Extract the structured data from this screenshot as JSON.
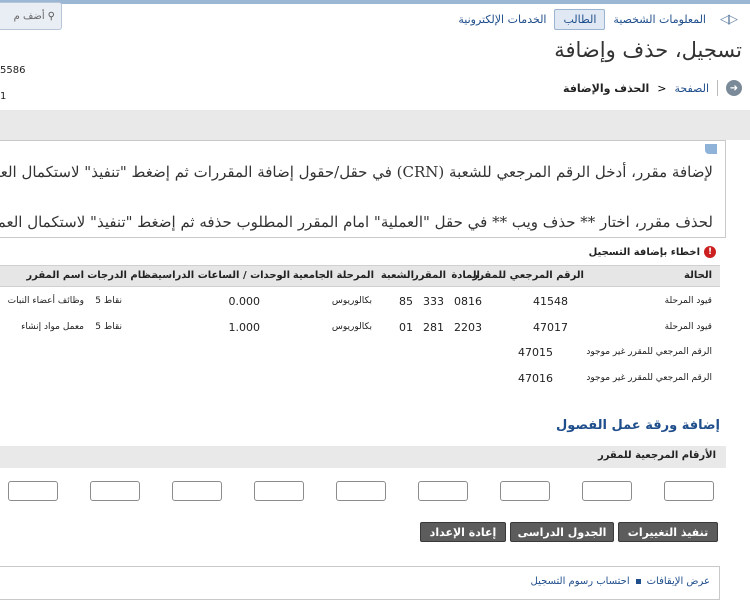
{
  "nav": {
    "tabs": [
      "المعلومات الشخصية",
      "الطالب",
      "الخدمات الإلكترونية"
    ],
    "active_index": 1
  },
  "search": {
    "placeholder": "أضف م"
  },
  "page": {
    "title": "تسجيل، حذف وإضافة",
    "left_number_1": "5586",
    "left_number_2": "1"
  },
  "breadcrumb": {
    "home": "الصفحة",
    "separator": ">",
    "current": "الحذف والإضافة"
  },
  "info": {
    "line1": "لإضافة مقرر، أدخل الرقم المرجعي للشعبة (CRN) في حقل/حقول إضافة المقررات ثم إضغط \"تنفيذ\" لاستكمال العملية.",
    "line2": "لحذف مقرر، اختار ** حذف ويب ** في حقل \"العملية\" امام المقرر المطلوب حذفه ثم إضغط \"تنفيذ\" لاستكمال العملية."
  },
  "errors": {
    "title": "اخطاء بإضافة التسجيل",
    "headers": [
      "الحالة",
      "الرقم المرجعي للمقرر",
      "المادة",
      "المقرر",
      "الشعبة",
      "المرحلة الجامعية",
      "الوحدات / الساعات الدراسية",
      "نظام الدرجات",
      "اسم المقرر"
    ],
    "rows": [
      {
        "status": "قيود المرحلة",
        "crn": "41548",
        "subject": "0816",
        "course": "333",
        "section": "85",
        "level": "بكالوريوس",
        "units": "0.000",
        "grading": "نقاط 5",
        "title": "وظائف أعضاء النبات"
      },
      {
        "status": "قيود المرحلة",
        "crn": "47017",
        "subject": "2203",
        "course": "281",
        "section": "01",
        "level": "بكالوريوس",
        "units": "1.000",
        "grading": "نقاط 5",
        "title": "معمل مواد إنشاء"
      },
      {
        "status": "الرقم المرجعي للمقرر غير موجود",
        "crn": "47015"
      },
      {
        "status": "الرقم المرجعي للمقرر غير موجود",
        "crn": "47016"
      }
    ]
  },
  "worksheet": {
    "title": "إضافة ورقة عمل الفصول",
    "crn_label": "الأرقام المرجعية للمقرر",
    "crn_values": [
      "",
      "",
      "",
      "",
      "",
      "",
      "",
      "",
      ""
    ]
  },
  "buttons": {
    "submit": "تنفيذ التغييرات",
    "schedule": "الجدول الدراسى",
    "reset": "إعادة الإعداد"
  },
  "footer": {
    "link1": "عرض الإيقافات",
    "link2": "احتساب رسوم التسجيل"
  },
  "colors": {
    "link": "#1f4e8c",
    "button_bg": "#5c5c5c",
    "header_bg": "#e6e6e6",
    "error": "#cc1f1f"
  }
}
